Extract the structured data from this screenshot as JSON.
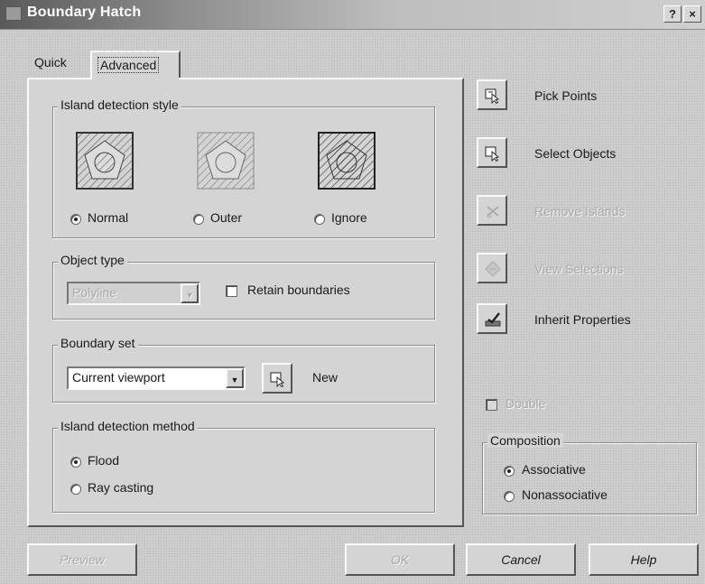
{
  "window": {
    "title": "Boundary Hatch",
    "help_btn": "?",
    "close_btn": "×"
  },
  "tabs": [
    {
      "label": "Quick",
      "active": false
    },
    {
      "label": "Advanced",
      "active": true
    }
  ],
  "island_style": {
    "label": "Island detection style",
    "options": [
      {
        "label": "Normal",
        "selected": true
      },
      {
        "label": "Outer",
        "selected": false
      },
      {
        "label": "Ignore",
        "selected": false
      }
    ]
  },
  "object_type": {
    "label": "Object type",
    "value": "Polyline",
    "retain_label": "Retain boundaries",
    "retain_checked": false
  },
  "boundary_set": {
    "label": "Boundary set",
    "value": "Current viewport",
    "new_label": "New"
  },
  "island_method": {
    "label": "Island detection method",
    "options": [
      {
        "label": "Flood",
        "selected": true
      },
      {
        "label": "Ray casting",
        "selected": false
      }
    ]
  },
  "actions": [
    {
      "label": "Pick Points",
      "enabled": true,
      "icon": "pick-points-icon"
    },
    {
      "label": "Select Objects",
      "enabled": true,
      "icon": "select-objects-icon"
    },
    {
      "label": "Remove Islands",
      "enabled": false,
      "icon": "remove-islands-icon"
    },
    {
      "label": "View Selections",
      "enabled": false,
      "icon": "view-selections-icon"
    },
    {
      "label": "Inherit Properties",
      "enabled": true,
      "icon": "inherit-properties-icon"
    }
  ],
  "double": {
    "label": "Double",
    "enabled": false
  },
  "composition": {
    "label": "Composition",
    "options": [
      {
        "label": "Associative",
        "selected": true
      },
      {
        "label": "Nonassociative",
        "selected": false
      }
    ]
  },
  "buttons": {
    "preview": "Preview",
    "ok": "OK",
    "cancel": "Cancel",
    "help": "Help"
  }
}
